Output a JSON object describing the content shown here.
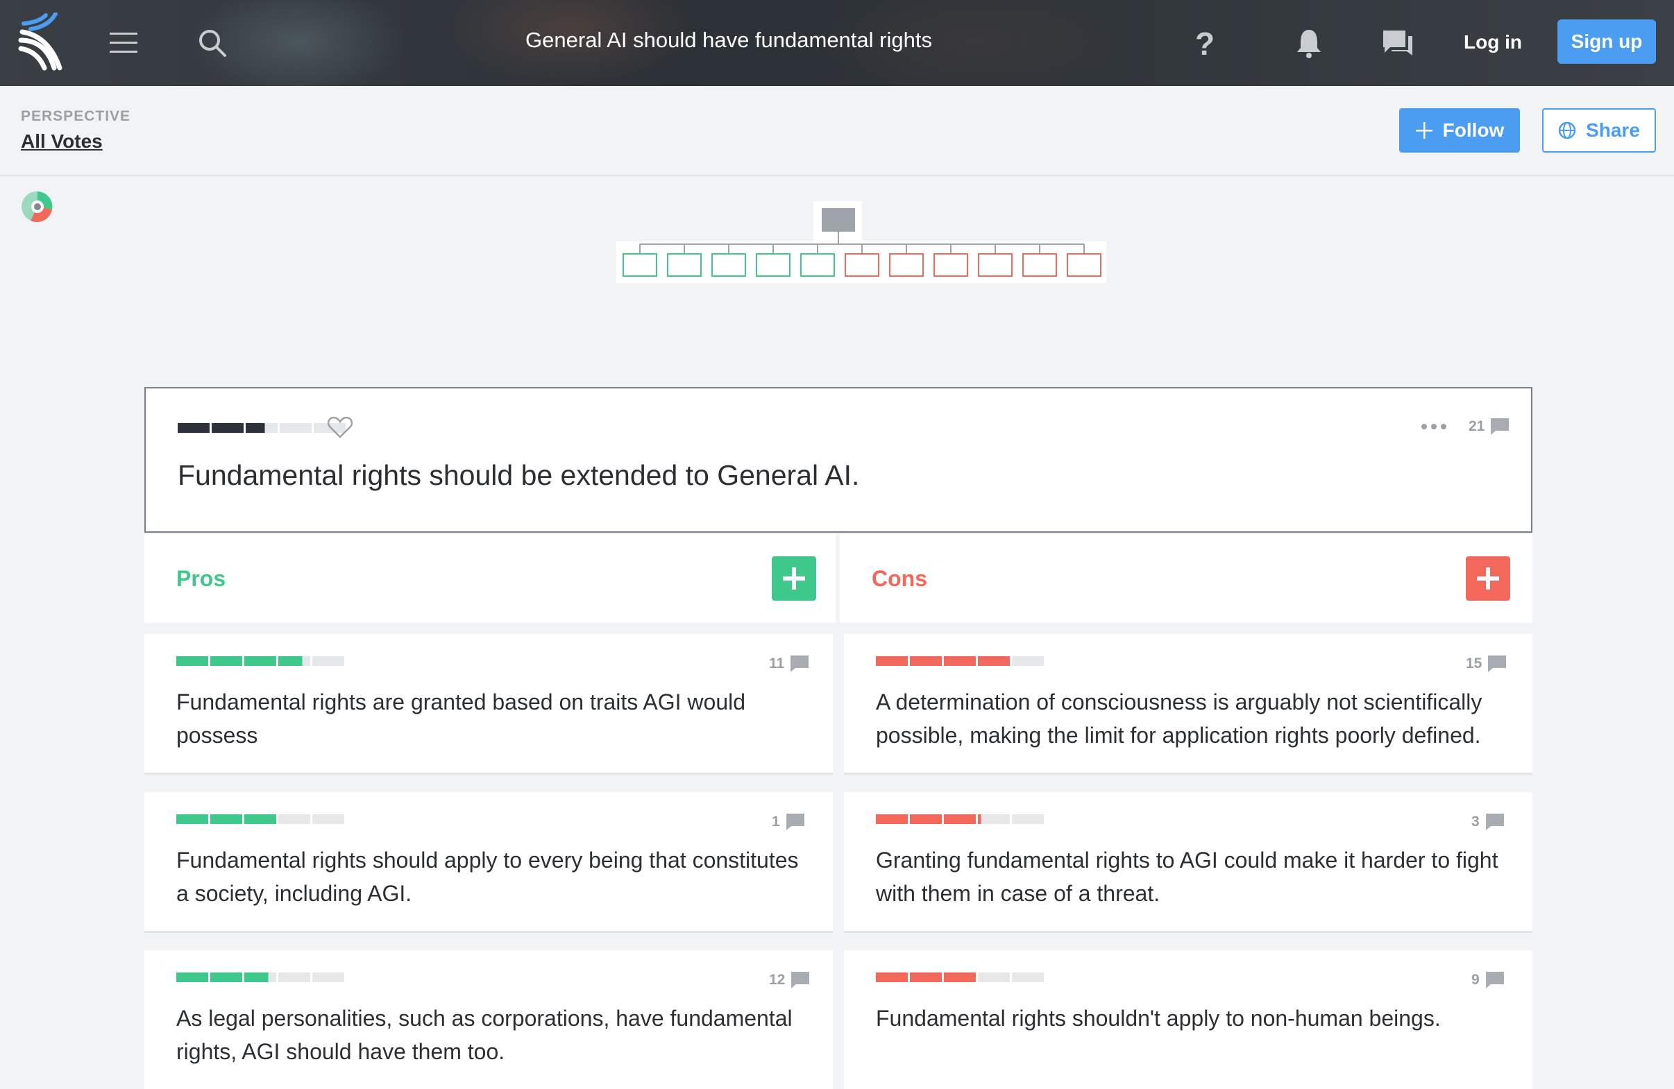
{
  "header": {
    "title": "General AI should have fundamental rights",
    "login_label": "Log in",
    "signup_label": "Sign up",
    "icons": [
      "kialo-logo-icon",
      "menu-icon",
      "search-icon",
      "help-icon",
      "bell-icon",
      "chat-icon"
    ]
  },
  "perspective": {
    "label": "PERSPECTIVE",
    "value": "All Votes"
  },
  "actions": {
    "follow_label": "Follow",
    "share_label": "Share"
  },
  "thesis": {
    "text": "Fundamental rights should be extended to General AI.",
    "comments": "21",
    "strength": 0.52
  },
  "tree": {
    "pro_nodes": 5,
    "con_nodes": 6
  },
  "pros": {
    "label": "Pros",
    "items": [
      {
        "text": "Fundamental rights are granted based on traits AGI would possess",
        "comments": "11",
        "strength": 0.75
      },
      {
        "text": "Fundamental rights should apply to every being that constitutes a society, including AGI.",
        "comments": "1",
        "strength": 0.6
      },
      {
        "text": "As legal personalities, such as corporations, have fundamental rights, AGI should have them too.",
        "comments": "12",
        "strength": 0.55
      }
    ]
  },
  "cons": {
    "label": "Cons",
    "items": [
      {
        "text": "A determination of consciousness is arguably not scientifically possible, making the limit for application rights poorly defined.",
        "comments": "15",
        "strength": 0.8
      },
      {
        "text": "Granting fundamental rights to AGI could make it harder to fight with them in case of a threat.",
        "comments": "3",
        "strength": 0.62
      },
      {
        "text": "Fundamental rights shouldn't apply to non-human beings.",
        "comments": "9",
        "strength": 0.6
      }
    ]
  },
  "colors": {
    "pro": "#3ec88c",
    "con": "#f2685a",
    "accent": "#4a9df0",
    "dark_bar": "#2b323a"
  }
}
